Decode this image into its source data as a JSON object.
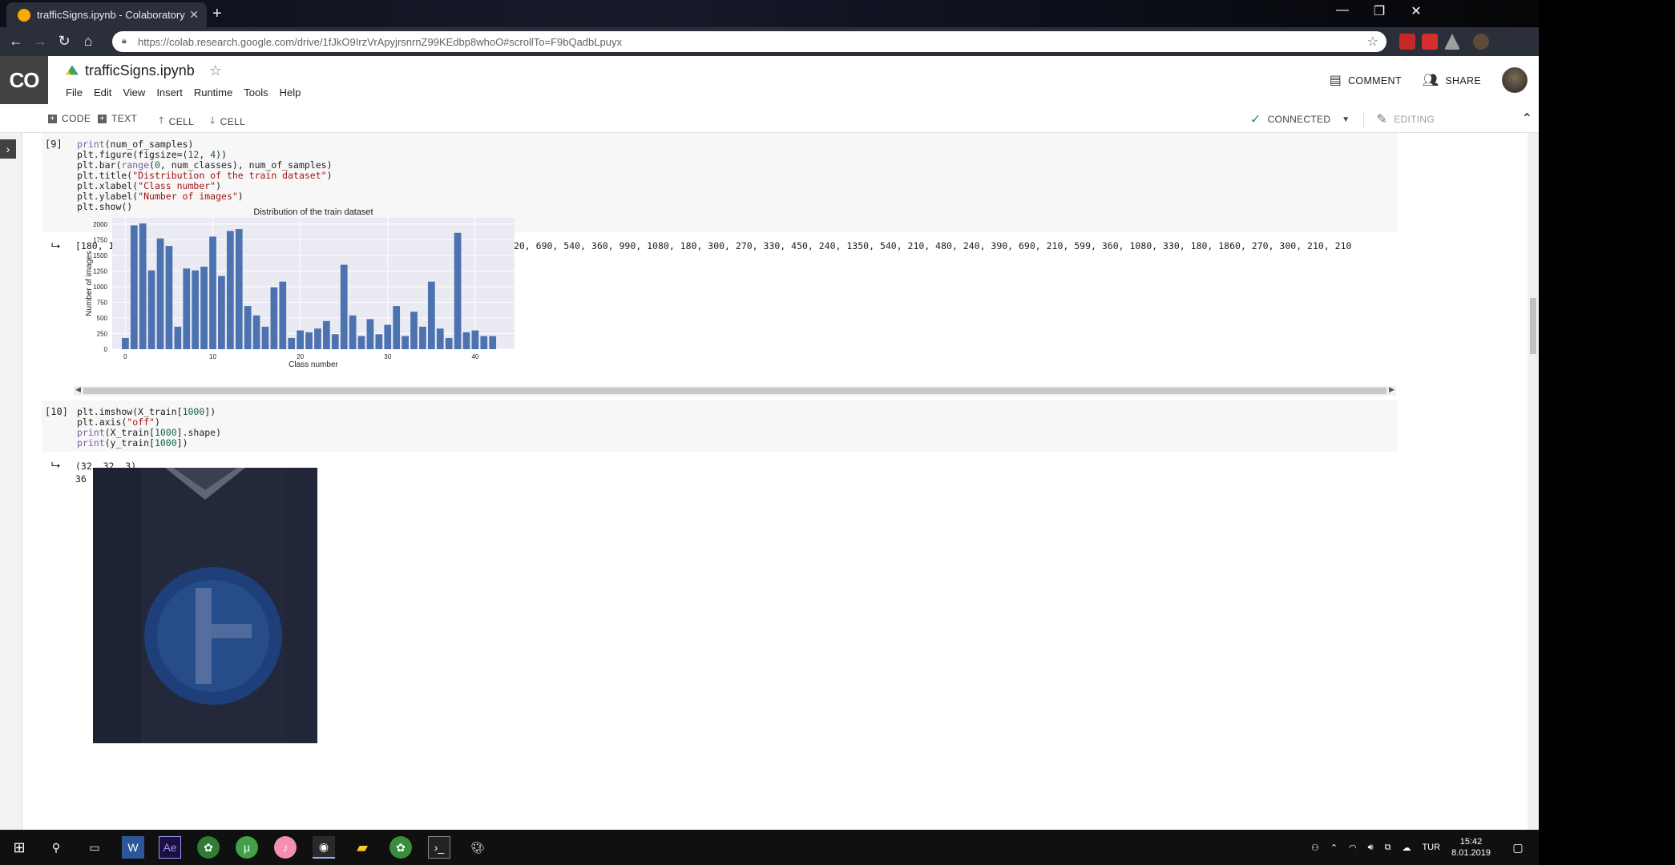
{
  "browser": {
    "tab_title": "trafficSigns.ipynb - Colaboratory",
    "url": "https://colab.research.google.com/drive/1fJkO9IrzVrApyjrsnrnZ99KEdbp8whoO#scrollTo=F9bQadbLpuyx"
  },
  "colab": {
    "logo": "CO",
    "notebook_title": "trafficSigns.ipynb",
    "menu": [
      "File",
      "Edit",
      "View",
      "Insert",
      "Runtime",
      "Tools",
      "Help"
    ],
    "comment_label": "COMMENT",
    "share_label": "SHARE",
    "toolbar": {
      "code_label": "CODE",
      "text_label": "TEXT",
      "cell_up_label": "CELL",
      "cell_down_label": "CELL",
      "connected_label": "CONNECTED",
      "editing_label": "EDITING"
    }
  },
  "cells": {
    "cell9": {
      "exec_count": "[9]",
      "output_text": "[180, 1980, 2010, 1260, 1770, 1650, 360, 1290, 1260, 1320, 1800, 1170, 1890, 1920, 690, 540, 360, 990, 1080, 180, 300, 270, 330, 450, 240, 1350, 540, 210, 480, 240, 390, 690, 210, 599, 360, 1080, 330, 180, 1860, 270, 300, 210, 210"
    },
    "cell10": {
      "exec_count": "[10]",
      "output_line1": "(32, 32, 3)",
      "output_line2": "36"
    }
  },
  "chart_data": {
    "type": "bar",
    "title": "Distribution of the train dataset",
    "xlabel": "Class number",
    "ylabel": "Number of images",
    "x": [
      0,
      1,
      2,
      3,
      4,
      5,
      6,
      7,
      8,
      9,
      10,
      11,
      12,
      13,
      14,
      15,
      16,
      17,
      18,
      19,
      20,
      21,
      22,
      23,
      24,
      25,
      26,
      27,
      28,
      29,
      30,
      31,
      32,
      33,
      34,
      35,
      36,
      37,
      38,
      39,
      40,
      41,
      42
    ],
    "values": [
      180,
      1980,
      2010,
      1260,
      1770,
      1650,
      360,
      1290,
      1260,
      1320,
      1800,
      1170,
      1890,
      1920,
      690,
      540,
      360,
      990,
      1080,
      180,
      300,
      270,
      330,
      450,
      240,
      1350,
      540,
      210,
      480,
      240,
      390,
      690,
      210,
      599,
      360,
      1080,
      330,
      180,
      1860,
      270,
      300,
      210,
      210
    ],
    "yticks": [
      0,
      250,
      500,
      750,
      1000,
      1250,
      1500,
      1750,
      2000
    ],
    "xticks": [
      0,
      10,
      20,
      30,
      40
    ],
    "ylim": [
      0,
      2100
    ],
    "xlim": [
      -1.5,
      44.5
    ],
    "grid": true,
    "bar_color": "#4c72b0",
    "background": "#eaeaf2"
  },
  "taskbar": {
    "lang": "TUR",
    "time": "15:42",
    "date": "8.01.2019"
  }
}
